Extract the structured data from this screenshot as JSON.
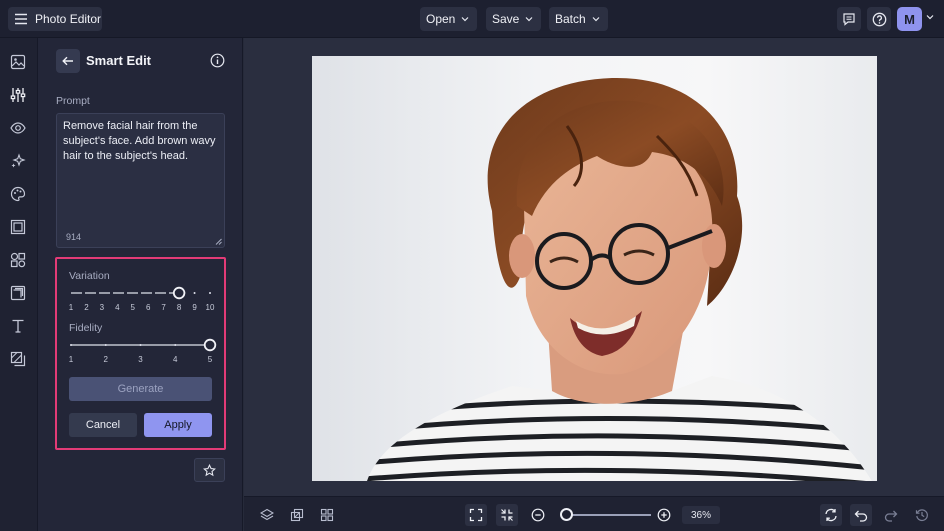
{
  "app": {
    "title": "Photo Editor"
  },
  "menus": [
    {
      "label": "Open"
    },
    {
      "label": "Save"
    },
    {
      "label": "Batch"
    }
  ],
  "user": {
    "initial": "M"
  },
  "panel": {
    "title": "Smart Edit",
    "prompt_label": "Prompt",
    "prompt_text": "Remove facial hair from the subject's face. Add brown wavy hair to the subject's head.",
    "char_count": "914",
    "variation": {
      "label": "Variation",
      "ticks": [
        "1",
        "2",
        "3",
        "4",
        "5",
        "6",
        "7",
        "8",
        "9",
        "10"
      ],
      "value": 8
    },
    "fidelity": {
      "label": "Fidelity",
      "ticks": [
        "1",
        "2",
        "3",
        "4",
        "5"
      ],
      "value": 5
    },
    "generate_label": "Generate",
    "cancel_label": "Cancel",
    "apply_label": "Apply"
  },
  "rail_icons": [
    "image-icon",
    "sliders-icon",
    "eye-icon",
    "sparkles-icon",
    "palette-icon",
    "frame-icon",
    "shapes-icon",
    "crop-icon",
    "text-icon",
    "texture-icon"
  ],
  "zoom": {
    "value": "36%",
    "level": 0.05
  },
  "colors": {
    "accent": "#8f95f0",
    "highlight": "#e23b77",
    "background": "#262a3a"
  }
}
